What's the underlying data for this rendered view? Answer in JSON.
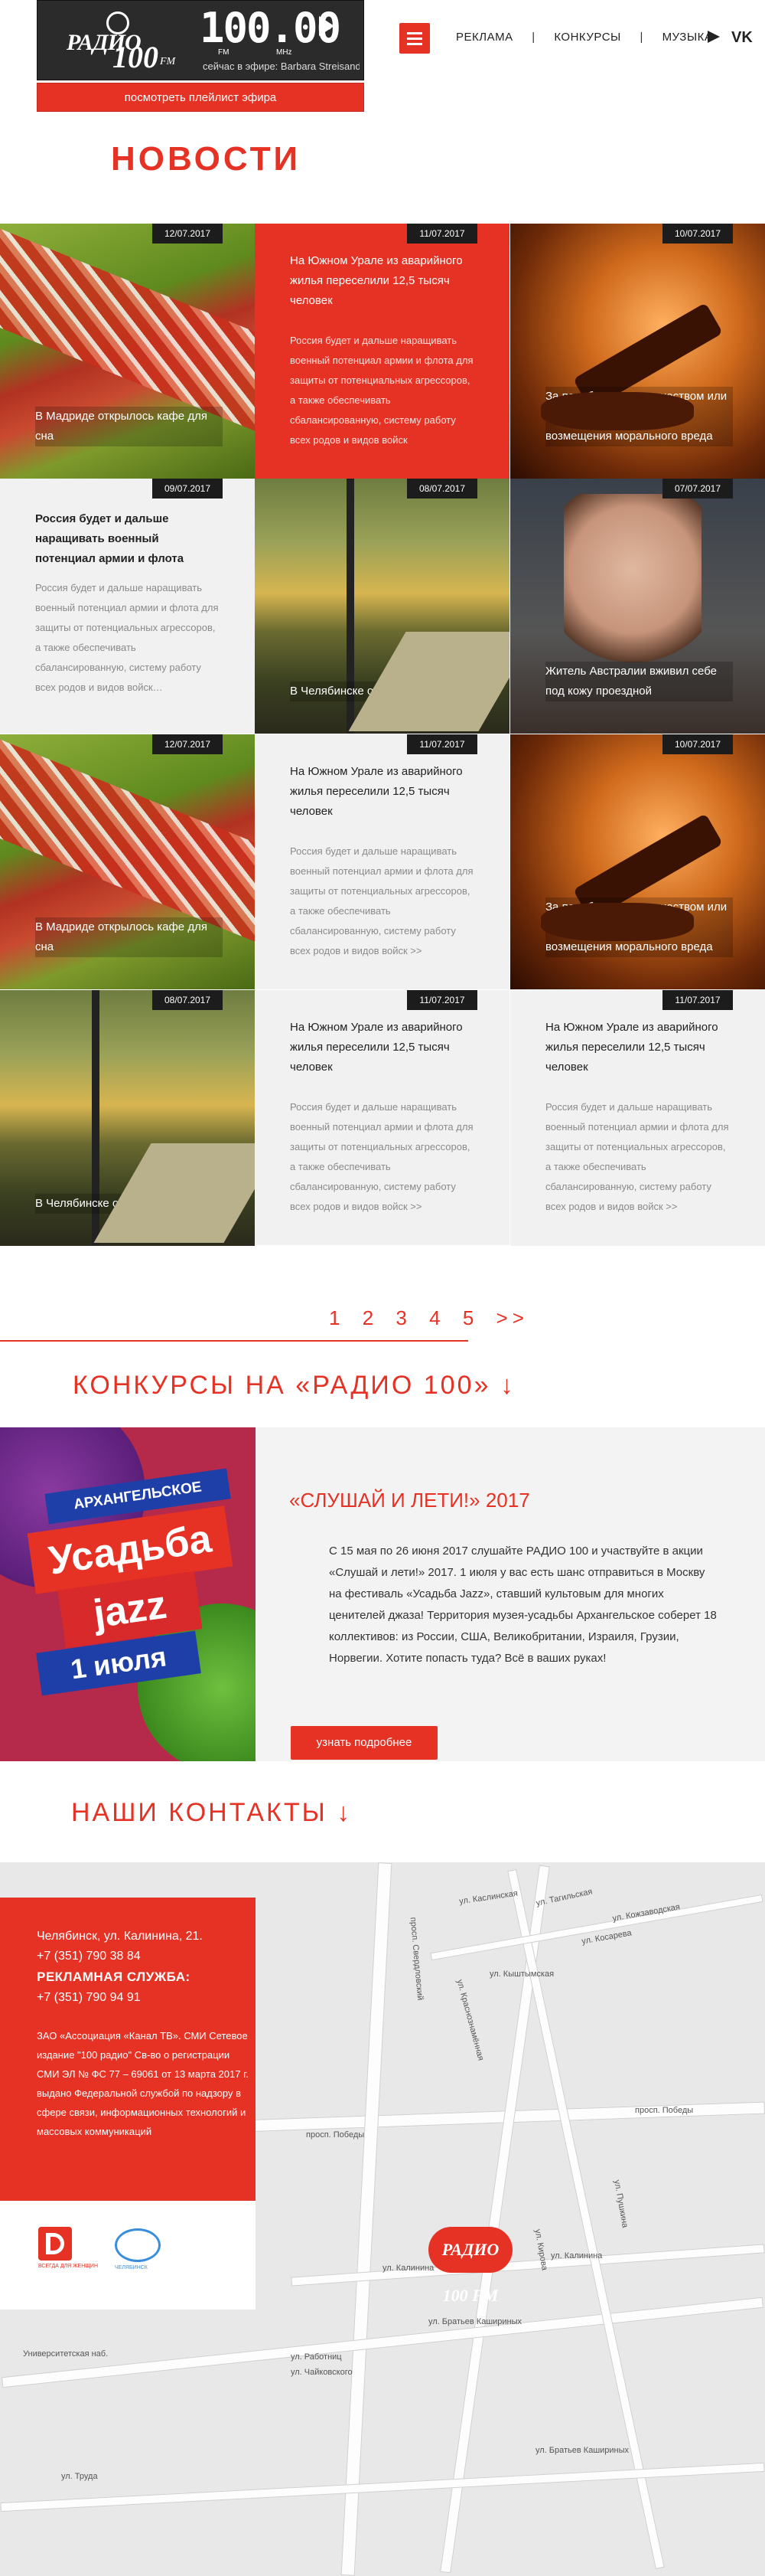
{
  "player": {
    "logo_radio": "РАДИО",
    "logo_num": "100",
    "logo_fm": "FM",
    "frequency": "100.00",
    "fm": "FM",
    "mhz": "MHz",
    "on_air": "сейчас в эфире: Barbara Streisand -",
    "playlist_button": "посмотреть плейлист эфира"
  },
  "nav": {
    "items": [
      "РЕКЛАМА",
      "КОНКУРСЫ",
      "МУЗЫКА"
    ],
    "separator": "|"
  },
  "social": {
    "icons": [
      "youtube-icon",
      "vk-icon"
    ],
    "vk_label": "VK"
  },
  "news": {
    "heading": "НОВОСТИ",
    "items": [
      {
        "date": "12/07.2017",
        "title": "В Мадриде открылось кафе для сна",
        "text": "",
        "image": "hammock"
      },
      {
        "date": "11/07.2017",
        "title": "На Южном Урале из аварийного жилья переселили 12,5 тысяч человек",
        "text": "Россия будет и дальше наращивать военный потенциал армии и флота для защиты от потенциальных агрессоров, а также обеспечивать сбалансированную, систему работу всех родов и видов войск",
        "image": ""
      },
      {
        "date": "10/07.2017",
        "title": "За перебои с электричеством или водой можно требовать возмещения морального вреда",
        "text": "",
        "image": "gavel"
      },
      {
        "date": "09/07.2017",
        "title": "Россия будет и дальше наращивать военный потенциал армии и флота",
        "text": "Россия будет и дальше наращивать военный потенциал армии и флота для защиты от потенциальных агрессоров, а также обеспечивать сбалансированную, систему работу всех родов и видов войск…",
        "image": ""
      },
      {
        "date": "08/07.2017",
        "title": "В Челябинске обновят два парка",
        "text": "",
        "image": "park"
      },
      {
        "date": "07/07.2017",
        "title": "Житель Австралии вживил себе под кожу проездной",
        "text": "",
        "image": "man"
      },
      {
        "date": "12/07.2017",
        "title": "В Мадриде открылось кафе для сна",
        "text": "",
        "image": "hammock"
      },
      {
        "date": "11/07.2017",
        "title": "На Южном Урале из аварийного жилья переселили 12,5 тысяч человек",
        "text": "Россия будет и дальше наращивать военный потенциал армии и флота для защиты от потенциальных агрессоров, а также обеспечивать сбалансированную, систему работу всех родов и видов войск >>",
        "image": ""
      },
      {
        "date": "10/07.2017",
        "title": "За перебои с электричеством или водой можно требовать возмещения морального вреда",
        "text": "",
        "image": "gavel"
      },
      {
        "date": "08/07.2017",
        "title": "В Челябинске обновят два парка",
        "text": "",
        "image": "park"
      },
      {
        "date": "11/07.2017",
        "title": "На Южном Урале из аварийного жилья переселили 12,5 тысяч человек",
        "text": "Россия будет и дальше наращивать военный потенциал армии и флота для защиты от потенциальных агрессоров, а также обеспечивать сбалансированную, систему работу всех родов и видов войск >>",
        "image": ""
      },
      {
        "date": "11/07.2017",
        "title": "На Южном Урале из аварийного жилья переселили 12,5 тысяч человек",
        "text": "Россия будет и дальше наращивать военный потенциал армии и флота для защиты от потенциальных агрессоров, а также обеспечивать сбалансированную, систему работу всех родов и видов войск >>",
        "image": ""
      }
    ]
  },
  "pagination": {
    "pages": [
      "1",
      "2",
      "3",
      "4",
      "5"
    ],
    "next": ">>"
  },
  "contests": {
    "heading": "КОНКУРСЫ НА «РАДИО 100» ↓",
    "promo_ribbon1": "АРХАНГЕЛЬСКОЕ",
    "promo_ribbon2": "Усадьба",
    "promo_ribbon3": "jazz",
    "promo_ribbon4": "1 июля",
    "title": "«СЛУШАЙ И ЛЕТИ!» 2017",
    "text": "С 15 мая по 26 июня 2017 слушайте РАДИО 100 и участвуйте в акции «Слушай и лети!» 2017. 1 июля у вас есть шанс отправиться в Москву на фестиваль «Усадьба Jazz», ставший культовым для многих ценителей джаза! Территория музея-усадьбы Архангельское соберет 18 коллективов: из России, США, Великобритании, Израиля, Грузии, Норвегии. Хотите попасть туда? Всё в ваших руках!",
    "button": "узнать подробнее"
  },
  "contacts": {
    "heading": "НАШИ КОНТАКТЫ ↓",
    "address": "Челябинск, ул. Калинина, 21.",
    "phone1": "+7 (351) 790 38 84",
    "ads_label": "РЕКЛАМНАЯ СЛУЖБА:",
    "phone2": "+7 (351) 790 94 91",
    "legal": "ЗАО «Ассоциация «Канал ТВ». СМИ Сетевое издание \"100 радио\" Св-во о регистрации СМИ ЭЛ № ФС 77 – 69061 от 13 марта 2017 г. выдано Федеральной службой по надзору в сфере связи, информационных технологий и массовых коммуникаций",
    "partner_caption": "ВСЕГДА ДЛЯ ЖЕНЩИН",
    "partner2_caption": "ЧЕЛЯБИНСК"
  },
  "map": {
    "labels": [
      "просп. Победы",
      "просп. Победы",
      "просп. Свердловский",
      "ул. Кирова",
      "ул. Калинина",
      "ул. Калинина",
      "ул. Краснознамённая",
      "ул. Каслинская",
      "ул. Тагильская",
      "ул. Труда",
      "ул. Братьев Кашириных",
      "ул. Братьев Кашириных",
      "ул. Работниц",
      "ул. Пушкина",
      "Университетская наб.",
      "ул. Кыштымская",
      "ул. Чайковского",
      "ул. Косарева",
      "ул. Кожзаводская"
    ],
    "pin_label": "РАДИО 100 FM"
  }
}
